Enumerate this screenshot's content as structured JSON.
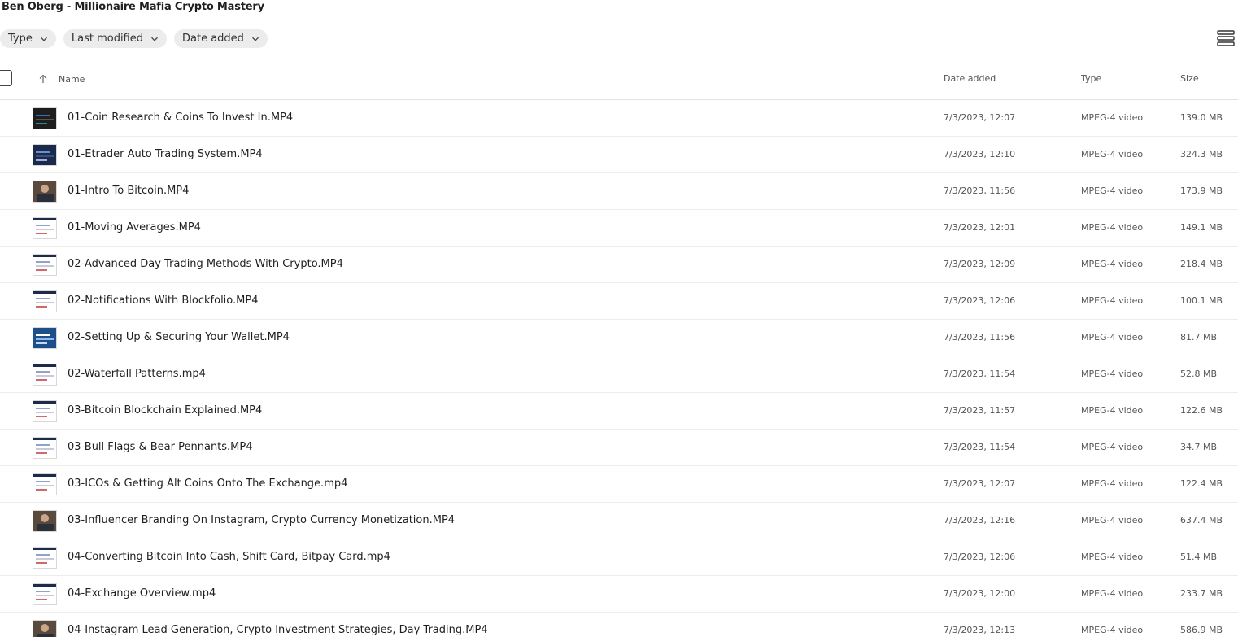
{
  "folder": {
    "title": "Ben Oberg - Millionaire Mafia Crypto Mastery"
  },
  "filters": [
    {
      "label": "Type"
    },
    {
      "label": "Last modified"
    },
    {
      "label": "Date added"
    }
  ],
  "columns": {
    "name": "Name",
    "date_added": "Date added",
    "type": "Type",
    "size": "Size"
  },
  "sort": {
    "column": "Name",
    "direction": "ascending",
    "icon": "arrow-up-icon"
  },
  "view_toggle": {
    "icon": "list-view-icon"
  },
  "files": [
    {
      "name": "01-Coin Research & Coins To Invest In.MP4",
      "date_added": "7/3/2023, 12:07",
      "type": "MPEG-4 video",
      "size": "139.0 MB",
      "thumb": "dark"
    },
    {
      "name": "01-Etrader Auto Trading System.MP4",
      "date_added": "7/3/2023, 12:10",
      "type": "MPEG-4 video",
      "size": "324.3 MB",
      "thumb": "navy"
    },
    {
      "name": "01-Intro To Bitcoin.MP4",
      "date_added": "7/3/2023, 11:56",
      "type": "MPEG-4 video",
      "size": "173.9 MB",
      "thumb": "face"
    },
    {
      "name": "01-Moving Averages.MP4",
      "date_added": "7/3/2023, 12:01",
      "type": "MPEG-4 video",
      "size": "149.1 MB",
      "thumb": "light"
    },
    {
      "name": "02-Advanced Day Trading Methods With Crypto.MP4",
      "date_added": "7/3/2023, 12:09",
      "type": "MPEG-4 video",
      "size": "218.4 MB",
      "thumb": "light"
    },
    {
      "name": "02-Notifications With Blockfolio.MP4",
      "date_added": "7/3/2023, 12:06",
      "type": "MPEG-4 video",
      "size": "100.1 MB",
      "thumb": "light"
    },
    {
      "name": "02-Setting Up & Securing Your Wallet.MP4",
      "date_added": "7/3/2023, 11:56",
      "type": "MPEG-4 video",
      "size": "81.7 MB",
      "thumb": "blue"
    },
    {
      "name": "02-Waterfall Patterns.mp4",
      "date_added": "7/3/2023, 11:54",
      "type": "MPEG-4 video",
      "size": "52.8 MB",
      "thumb": "light"
    },
    {
      "name": "03-Bitcoin Blockchain Explained.MP4",
      "date_added": "7/3/2023, 11:57",
      "type": "MPEG-4 video",
      "size": "122.6 MB",
      "thumb": "light"
    },
    {
      "name": "03-Bull Flags & Bear Pennants.MP4",
      "date_added": "7/3/2023, 11:54",
      "type": "MPEG-4 video",
      "size": "34.7 MB",
      "thumb": "light"
    },
    {
      "name": "03-ICOs & Getting Alt Coins Onto The Exchange.mp4",
      "date_added": "7/3/2023, 12:07",
      "type": "MPEG-4 video",
      "size": "122.4 MB",
      "thumb": "light"
    },
    {
      "name": "03-Influencer Branding On Instagram, Crypto Currency Monetization.MP4",
      "date_added": "7/3/2023, 12:16",
      "type": "MPEG-4 video",
      "size": "637.4 MB",
      "thumb": "face"
    },
    {
      "name": "04-Converting Bitcoin Into Cash, Shift Card, Bitpay Card.mp4",
      "date_added": "7/3/2023, 12:06",
      "type": "MPEG-4 video",
      "size": "51.4 MB",
      "thumb": "light"
    },
    {
      "name": "04-Exchange Overview.mp4",
      "date_added": "7/3/2023, 12:00",
      "type": "MPEG-4 video",
      "size": "233.7 MB",
      "thumb": "light"
    },
    {
      "name": "04-Instagram Lead Generation, Crypto Investment Strategies, Day Trading.MP4",
      "date_added": "7/3/2023, 12:13",
      "type": "MPEG-4 video",
      "size": "586.9 MB",
      "thumb": "face"
    }
  ]
}
